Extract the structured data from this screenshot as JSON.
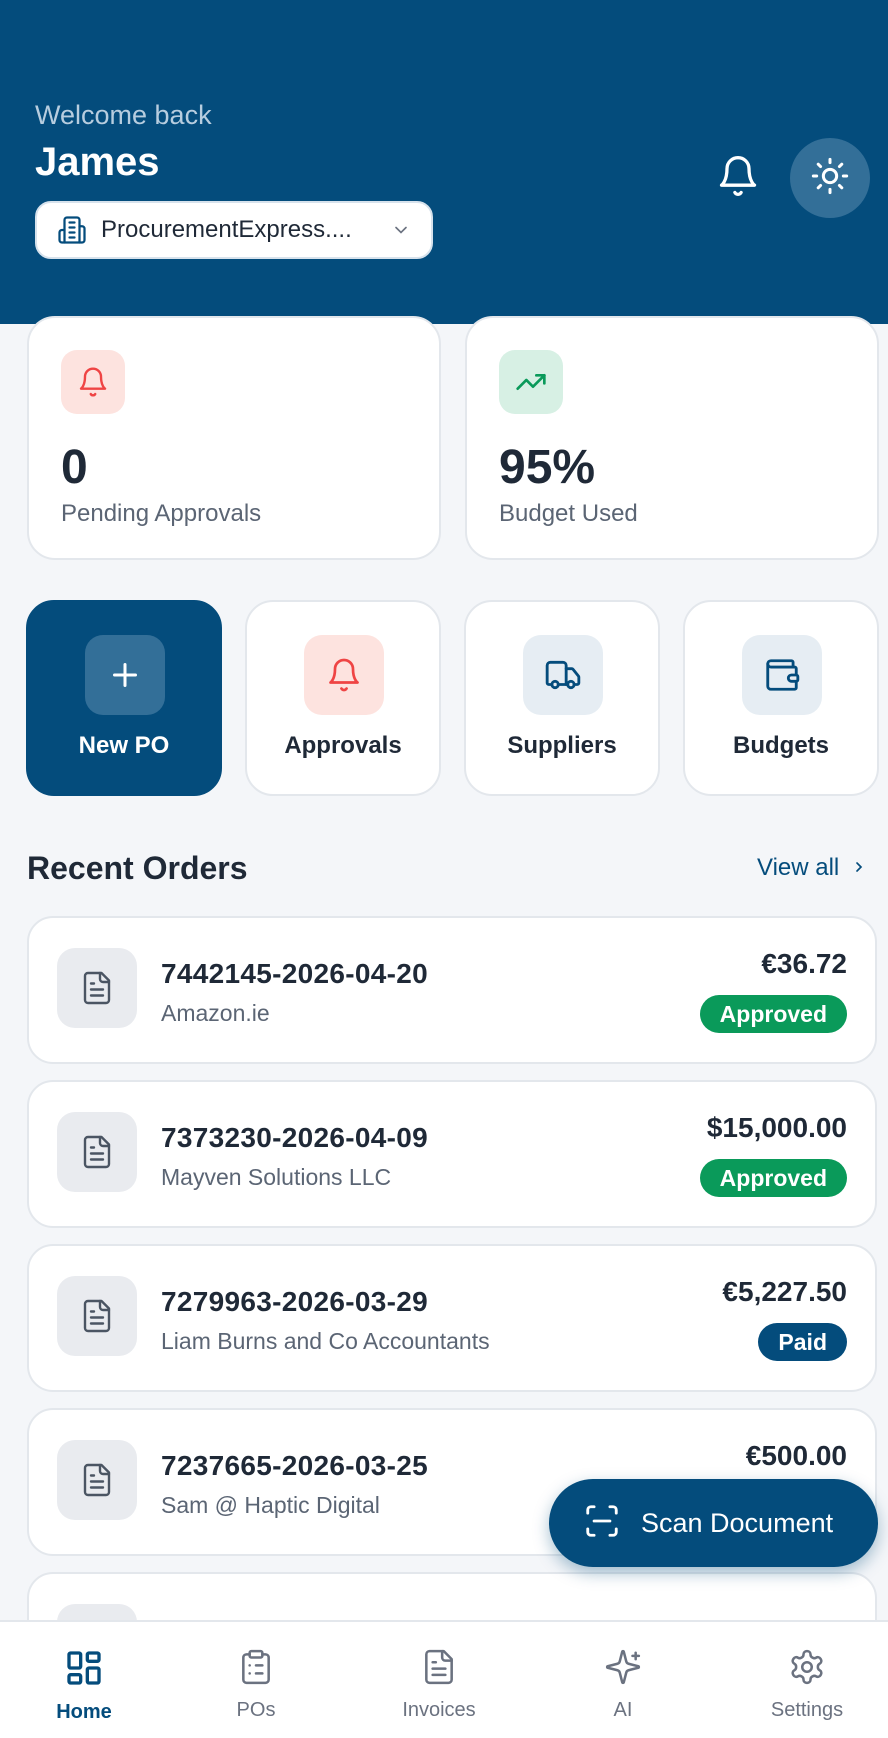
{
  "header": {
    "welcome": "Welcome back",
    "username": "James",
    "org_name": "ProcurementExpress...."
  },
  "stats": [
    {
      "value": "0",
      "label": "Pending Approvals",
      "icon": "bell-icon",
      "color": "#ef4444"
    },
    {
      "value": "95%",
      "label": "Budget Used",
      "icon": "trending-up-icon",
      "color": "#0a9a5a"
    }
  ],
  "quick_actions": [
    {
      "label": "New PO",
      "icon": "plus-icon"
    },
    {
      "label": "Approvals",
      "icon": "bell-icon"
    },
    {
      "label": "Suppliers",
      "icon": "truck-icon"
    },
    {
      "label": "Budgets",
      "icon": "wallet-icon"
    }
  ],
  "recent": {
    "title": "Recent Orders",
    "view_all": "View all",
    "orders": [
      {
        "po": "7442145-2026-04-20",
        "supplier": "Amazon.ie",
        "amount": "€36.72",
        "status": "Approved"
      },
      {
        "po": "7373230-2026-04-09",
        "supplier": "Mayven Solutions LLC",
        "amount": "$15,000.00",
        "status": "Approved"
      },
      {
        "po": "7279963-2026-03-29",
        "supplier": "Liam Burns and Co Accountants",
        "amount": "€5,227.50",
        "status": "Paid"
      },
      {
        "po": "7237665-2026-03-25",
        "supplier": "Sam @ Haptic Digital",
        "amount": "€500.00",
        "status": ""
      }
    ]
  },
  "scan": {
    "label": "Scan Document"
  },
  "nav": [
    {
      "label": "Home",
      "active": true
    },
    {
      "label": "POs"
    },
    {
      "label": "Invoices"
    },
    {
      "label": "AI"
    },
    {
      "label": "Settings"
    }
  ],
  "colors": {
    "brand": "#044c7c",
    "approved": "#0a9a5a",
    "paid": "#044c7c"
  }
}
